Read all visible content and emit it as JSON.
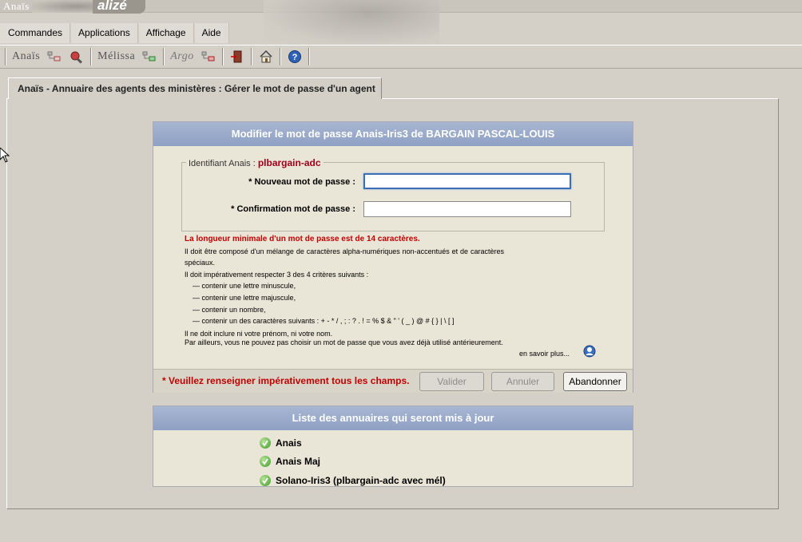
{
  "header": {
    "app_name": "Anaïs",
    "suite_name": "alizé",
    "menu": [
      "Commandes",
      "Applications",
      "Affichage",
      "Aide"
    ]
  },
  "toolbar": {
    "anais_label": "Anaïs",
    "melissa_label": "Mélissa",
    "argo_label": "Argo"
  },
  "tab": {
    "title": "Anaïs - Annuaire des agents des ministères : Gérer le mot de passe d'un agent"
  },
  "form": {
    "title": "Modifier le mot de passe Anais-Iris3 de BARGAIN PASCAL-LOUIS",
    "identifiant_label": "Identifiant Anais :",
    "identifiant_value": "plbargain-adc",
    "new_password_label": "* Nouveau mot de passe  :",
    "new_password_value": "",
    "confirm_password_label": "* Confirmation mot de passe  :",
    "confirm_password_value": "",
    "rules": {
      "min_length": "La longueur minimale d'un mot de passe est de 14 caractères.",
      "composition": "Il doit être composé d'un mélange de caractères alpha-numériques non-accentués et de caractères spéciaux.",
      "criteria_intro": "Il doit impérativement respecter 3 des 4 critères suivants :",
      "criteria": [
        "— contenir une lettre minuscule,",
        "— contenir une lettre majuscule,",
        "— contenir un nombre,",
        "— contenir un des caractères suivants : + - * / , ; : ? . ! = % $ & \" ' ( _ ) @ # { } | \\ [ ]"
      ],
      "no_name": "Il ne doit inclure ni votre prénom, ni votre nom.",
      "no_reuse": "Par ailleurs, vous ne pouvez pas choisir un mot de passe que vous avez déjà utilisé antérieurement."
    },
    "more_link": "en savoir plus...",
    "required_note": "* Veuillez renseigner impérativement tous les champs.",
    "buttons": {
      "validate": "Valider",
      "cancel": "Annuler",
      "abandon": "Abandonner"
    }
  },
  "directories": {
    "title": "Liste des annuaires qui seront mis à jour",
    "items": [
      "Anais",
      "Anais Maj",
      "Solano-Iris3  (plbargain-adc avec mél)"
    ]
  }
}
